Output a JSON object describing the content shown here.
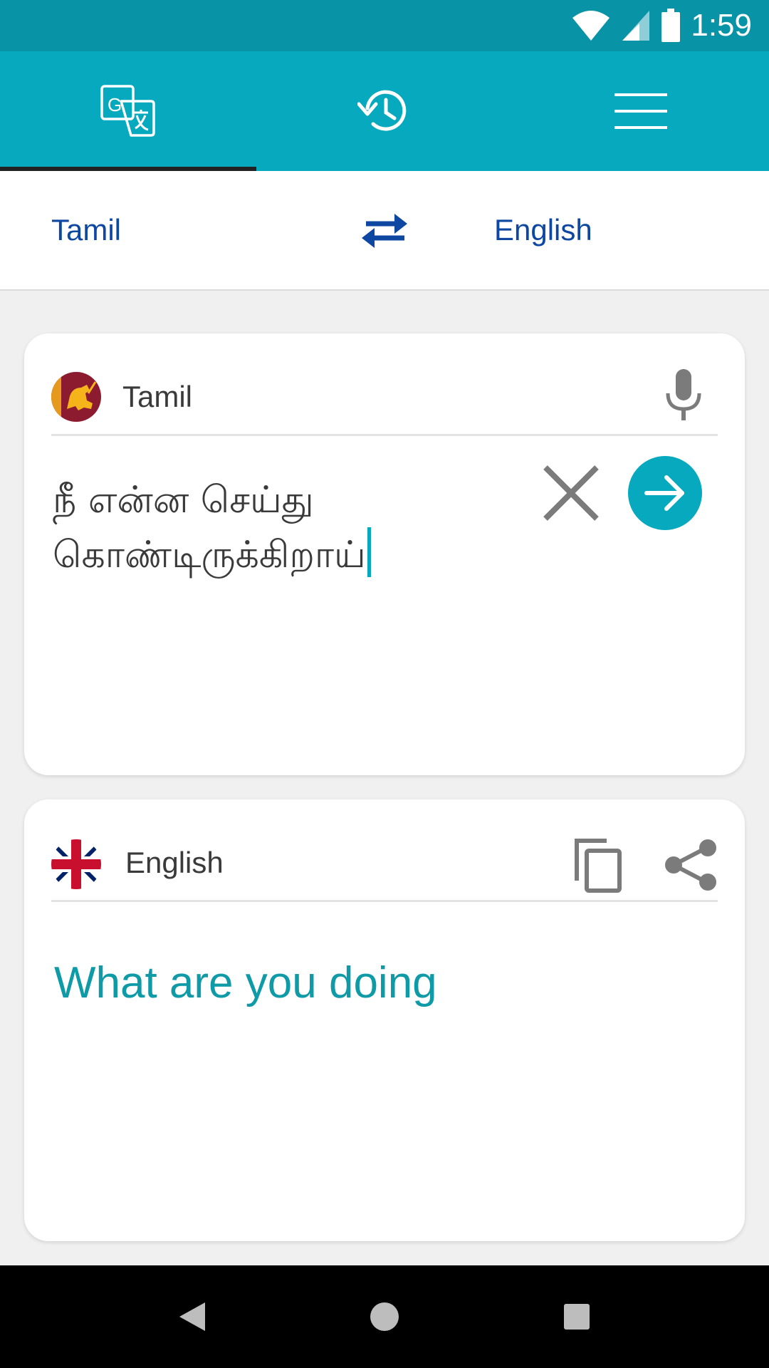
{
  "status_bar": {
    "time": "1:59",
    "icons": [
      "wifi-icon",
      "cell-signal-icon",
      "battery-icon"
    ]
  },
  "toolbar": {
    "tabs": [
      {
        "icon": "translate-icon",
        "selected": true
      },
      {
        "icon": "history-icon",
        "selected": false
      },
      {
        "icon": "menu-icon",
        "selected": false
      }
    ],
    "background": "#06a9bd"
  },
  "language_bar": {
    "source_language": "Tamil",
    "target_language": "English",
    "swap_icon": "swap-arrows-icon"
  },
  "source_card": {
    "language": "Tamil",
    "flag_icon": "sri-lanka-flag-icon",
    "text": "நீ என்ன செய்து கொண்டிருக்கிறாய்",
    "mic_icon": "microphone-icon",
    "clear_icon": "close-icon",
    "translate_icon": "arrow-right-icon"
  },
  "output_card": {
    "language": "English",
    "flag_icon": "uk-flag-icon",
    "text": "What are you doing",
    "copy_icon": "copy-icon",
    "share_icon": "share-icon"
  },
  "colors": {
    "status_bar": "#0893a6",
    "accent": "#06a9bd",
    "language_link": "#0d47a1",
    "output_text": "#0e9aa7"
  }
}
